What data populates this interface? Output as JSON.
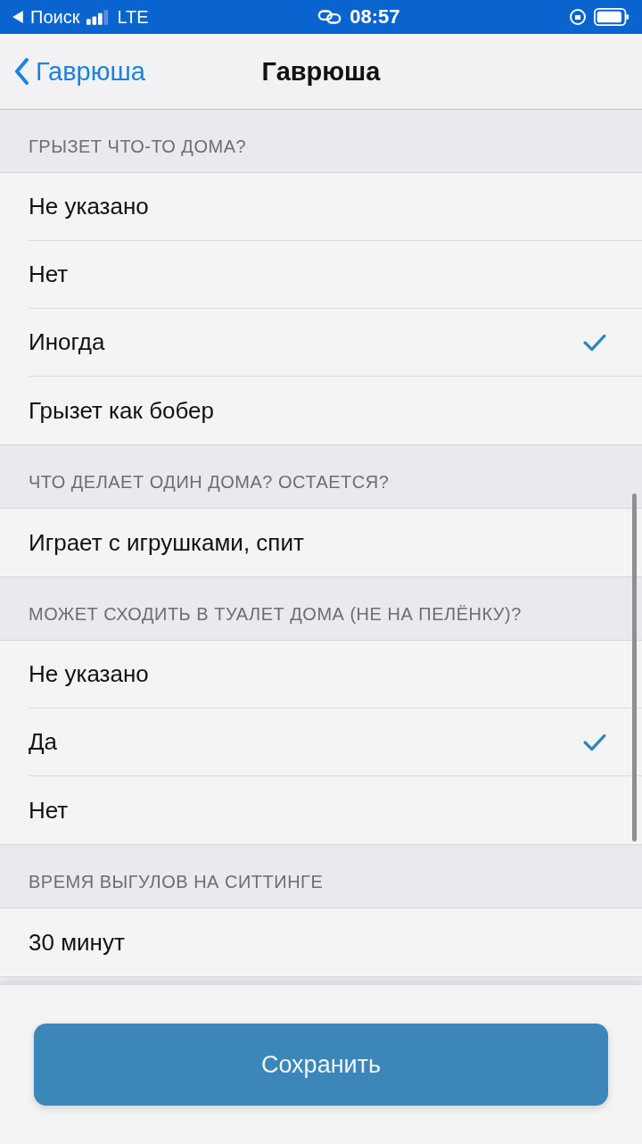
{
  "status_bar": {
    "back_app": "Поиск",
    "network": "LTE",
    "time": "08:57"
  },
  "nav": {
    "back": "Гаврюша",
    "title": "Гаврюша"
  },
  "sections": [
    {
      "header": "ГРЫЗЕТ ЧТО-ТО ДОМА?",
      "kind": "choice",
      "options": [
        {
          "label": "Не указано",
          "selected": false
        },
        {
          "label": "Нет",
          "selected": false
        },
        {
          "label": "Иногда",
          "selected": true
        },
        {
          "label": "Грызет как бобер",
          "selected": false
        }
      ]
    },
    {
      "header": "ЧТО ДЕЛАЕТ ОДИН ДОМА? ОСТАЕТСЯ?",
      "kind": "text",
      "value": "Играет с игрушками, спит"
    },
    {
      "header": "МОЖЕТ СХОДИТЬ В ТУАЛЕТ ДОМА (НЕ НА ПЕЛЁНКУ)?",
      "kind": "choice",
      "options": [
        {
          "label": "Не указано",
          "selected": false
        },
        {
          "label": "Да",
          "selected": true
        },
        {
          "label": "Нет",
          "selected": false
        }
      ]
    },
    {
      "header": "ВРЕМЯ ВЫГУЛОВ НА СИТТИНГЕ",
      "kind": "text",
      "value": "30 минут"
    }
  ],
  "save_button": "Сохранить"
}
